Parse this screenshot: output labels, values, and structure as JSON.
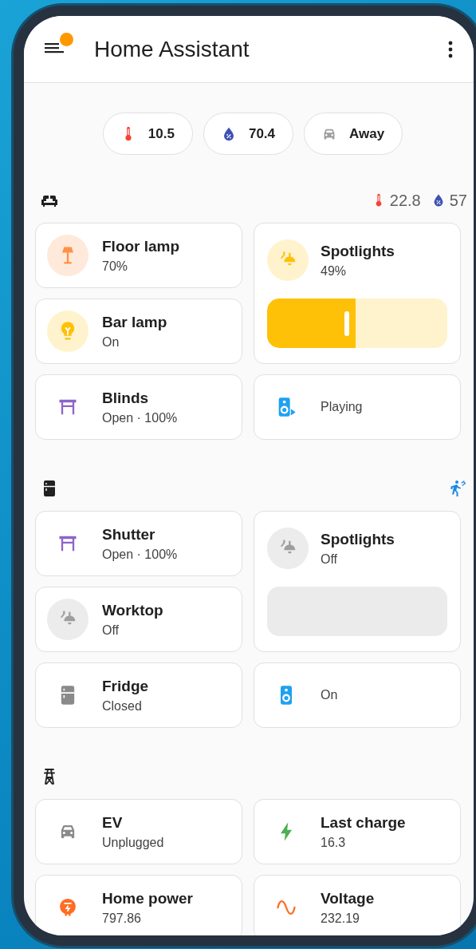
{
  "app_bar": {
    "title": "Home Assistant",
    "notification": true
  },
  "chips": [
    {
      "kind": "thermometer",
      "value": "10.5",
      "color": "#f44336"
    },
    {
      "kind": "drop",
      "value": "70.4",
      "color": "#3f51b5"
    },
    {
      "kind": "car",
      "value": "Away",
      "color": "#9e9e9e"
    }
  ],
  "sections": [
    {
      "kind": "sofa",
      "indicators": [
        {
          "kind": "thermometer",
          "value": "22.8",
          "color": "#f44336"
        },
        {
          "kind": "drop",
          "value": "57",
          "color": "#3f51b5"
        }
      ],
      "tiles": [
        {
          "kind": "lamp",
          "name": "Floor lamp",
          "state": "70%",
          "color": "#ff9147",
          "on": true
        },
        {
          "kind": "spotlight",
          "name": "Spotlights",
          "state": "49%",
          "color": "#ffc107",
          "on": true,
          "slider": true,
          "level": 0.49
        },
        {
          "kind": "bulb",
          "name": "Bar lamp",
          "state": "On",
          "color": "#ffc107",
          "on": true
        },
        {
          "kind": "blinds",
          "name": "Blinds",
          "state": "Open · 100%",
          "color": "#8e64c8"
        },
        {
          "kind": "media",
          "state": "Playing",
          "color": "#1ea1f2"
        }
      ]
    },
    {
      "kind": "fridge",
      "indicators": [
        {
          "kind": "motion",
          "color": "#1e88e5"
        }
      ],
      "tiles": [
        {
          "kind": "blinds",
          "name": "Shutter",
          "state": "Open · 100%",
          "color": "#8e64c8"
        },
        {
          "kind": "spotlight",
          "name": "Spotlights",
          "state": "Off",
          "on": false,
          "slider": true
        },
        {
          "kind": "spotlight",
          "name": "Worktop",
          "state": "Off",
          "on": false
        },
        {
          "kind": "fridge",
          "name": "Fridge",
          "state": "Closed",
          "color": "#8a8a8a"
        },
        {
          "kind": "speaker",
          "state": "On",
          "color": "#1ea1f2"
        }
      ]
    },
    {
      "kind": "tower",
      "tiles": [
        {
          "kind": "car",
          "name": "EV",
          "state": "Unplugged",
          "color": "#8a8a8a"
        },
        {
          "kind": "bolt",
          "name": "Last charge",
          "state": "16.3",
          "color": "#4caf50"
        },
        {
          "kind": "meter",
          "name": "Home power",
          "state": "797.86",
          "color": "#ff6d22"
        },
        {
          "kind": "wave",
          "name": "Voltage",
          "state": "232.19",
          "color": "#ff6d22"
        }
      ]
    }
  ]
}
